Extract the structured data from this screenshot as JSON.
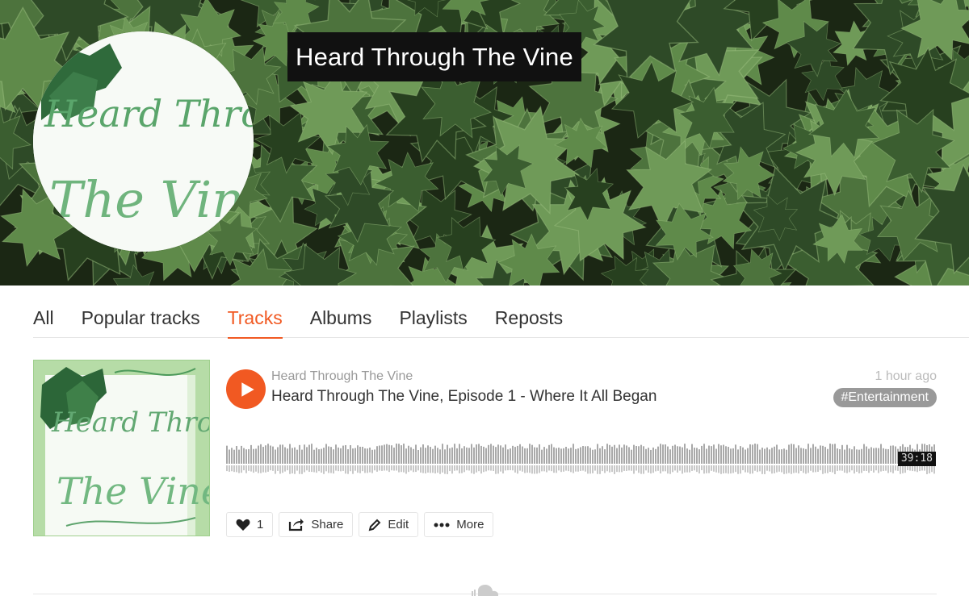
{
  "header": {
    "title": "Heard Through The Vine",
    "avatar_text_line1": "Heard Through",
    "avatar_text_line2": "The Vine"
  },
  "tabs": [
    {
      "label": "All",
      "active": false
    },
    {
      "label": "Popular tracks",
      "active": false
    },
    {
      "label": "Tracks",
      "active": true
    },
    {
      "label": "Albums",
      "active": false
    },
    {
      "label": "Playlists",
      "active": false
    },
    {
      "label": "Reposts",
      "active": false
    }
  ],
  "track": {
    "uploader": "Heard Through The Vine",
    "title": "Heard Through The Vine, Episode 1 - Where It All Began",
    "time_ago": "1 hour ago",
    "tag": "#Entertainment",
    "duration": "39:18",
    "artwork_text_line1": "Heard Through",
    "artwork_text_line2": "The Vine",
    "actions": {
      "like_count": "1",
      "share_label": "Share",
      "edit_label": "Edit",
      "more_label": "More"
    }
  },
  "colors": {
    "accent": "#f15922",
    "tag_bg": "#999999",
    "waveform": "#a9a9a9"
  },
  "icons": {
    "play": "play-icon",
    "like": "heart-icon",
    "share": "share-icon",
    "edit": "pencil-icon",
    "more": "more-dots-icon",
    "footer": "soundcloud-cloud-icon"
  }
}
